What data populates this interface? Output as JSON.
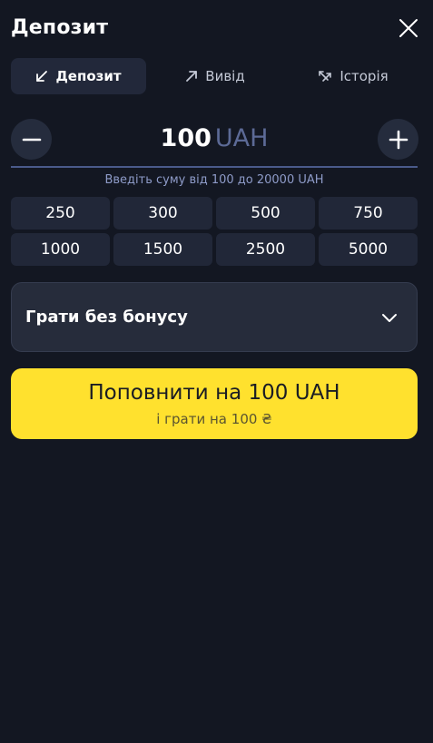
{
  "header": {
    "title": "Депозит",
    "close_icon": "close-icon"
  },
  "tabs": [
    {
      "label": "Депозит",
      "icon": "arrow-down-left-icon",
      "active": true
    },
    {
      "label": "Вивід",
      "icon": "arrow-up-right-icon",
      "active": false
    },
    {
      "label": "Історія",
      "icon": "swap-arrows-icon",
      "active": false
    }
  ],
  "amount": {
    "value": "100",
    "currency": "UAH",
    "hint": "Введіть суму від 100 до 20000 UAH"
  },
  "presets": [
    "250",
    "300",
    "500",
    "750",
    "1000",
    "1500",
    "2500",
    "5000"
  ],
  "bonus": {
    "selected": "Грати без бонусу"
  },
  "deposit_button": {
    "main_label": "Поповнити на 100 UAH",
    "sub_label": "і грати на 100 ₴"
  },
  "colors": {
    "background": "#131722",
    "accent": "#ffe12e",
    "currency": "#5c6a96"
  }
}
